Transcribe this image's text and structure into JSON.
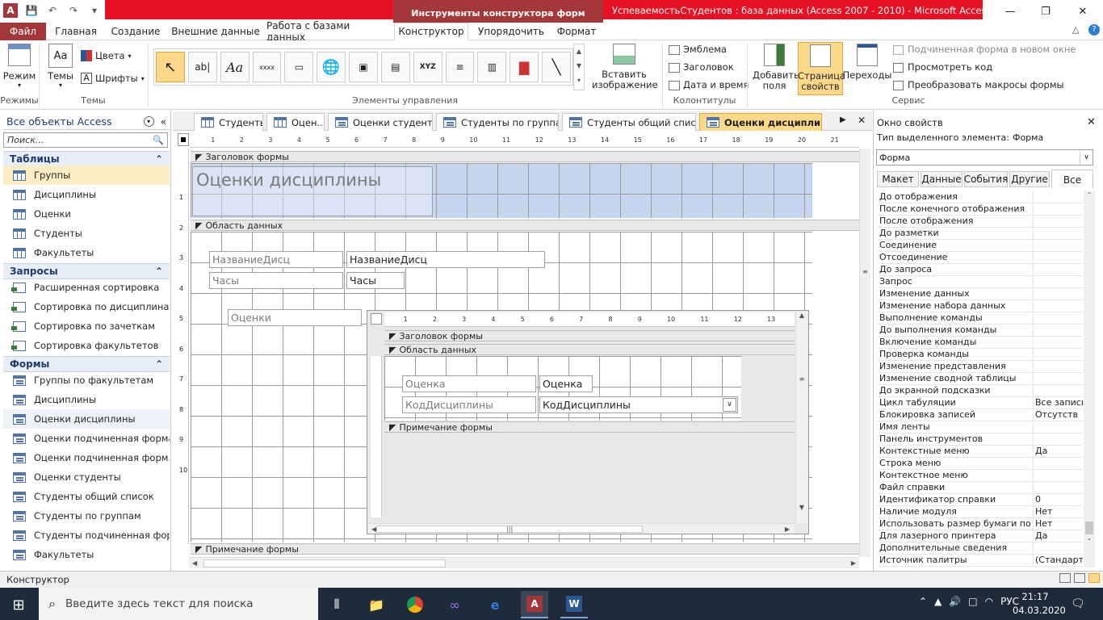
{
  "window": {
    "context_tools": "Инструменты конструктора форм",
    "title": "УспеваемостьСтудентов : база данных (Access 2007 - 2010) -  Microsoft Access (С...",
    "help": "?"
  },
  "ribbon_tabs": [
    "Файл",
    "Главная",
    "Создание",
    "Внешние данные",
    "Работа с базами данных",
    "Конструктор",
    "Упорядочить",
    "Формат"
  ],
  "ribbon": {
    "mode_label": "Режим",
    "themes_label": "Темы",
    "colors_label": "Цвета",
    "fonts_label": "Шрифты",
    "insert_image_label": "Вставить изображение",
    "emblem": "Эмблема",
    "header": "Заголовок",
    "datetime": "Дата и время",
    "add_fields": "Добавить поля",
    "property_sheet": "Страница свойств",
    "transitions": "Переходы",
    "subform_new_window": "Подчиненная форма в новом окне",
    "view_code": "Просмотреть код",
    "convert_macros": "Преобразовать макросы формы",
    "groups": {
      "modes": "Режимы",
      "themes": "Темы",
      "controls": "Элементы управления",
      "header_footer": "Колонтитулы",
      "service": "Сервис"
    },
    "controls_xyz": "XYZ",
    "controls_textbox": "ab|",
    "controls_label": "Aa",
    "controls_button": "xxxx"
  },
  "nav": {
    "title": "Все объекты Access",
    "search_placeholder": "Поиск...",
    "tables_header": "Таблицы",
    "tables": [
      "Группы",
      "Дисциплины",
      "Оценки",
      "Студенты",
      "Факультеты"
    ],
    "queries_header": "Запросы",
    "queries": [
      "Расширенная сортировка",
      "Сортировка по дисциплинам",
      "Сортировка по зачеткам",
      "Сортировка факультетов"
    ],
    "forms_header": "Формы",
    "forms": [
      "Группы по факультетам",
      "Дисциплины",
      "Оценки дисциплины",
      "Оценки подчиненная форма",
      "Оценки подчиненная форм...",
      "Оценки студенты",
      "Студенты общий список",
      "Студенты по группам",
      "Студенты подчиненная фор...",
      "Факультеты"
    ]
  },
  "doc_tabs": [
    "Студенты",
    "Оцен...",
    "Оценки студенты",
    "Студенты по группам",
    "Студенты общий список",
    "Оценки дисциплины"
  ],
  "design": {
    "ruler_marks": [
      "1",
      "2",
      "3",
      "4",
      "5",
      "6",
      "7",
      "8",
      "9",
      "10",
      "11",
      "12",
      "13",
      "14",
      "15",
      "16",
      "17",
      "18",
      "19",
      "20",
      "21"
    ],
    "vruler_marks": [
      "1",
      "2",
      "3",
      "4",
      "5",
      "6",
      "7",
      "8",
      "9",
      "10"
    ],
    "form_header": "Заголовок формы",
    "form_title": "Оценки дисциплины",
    "detail": "Область данных",
    "label_name": "НазваниеДисц",
    "field_name": "НазваниеДисц",
    "label_hours": "Часы",
    "field_hours": "Часы",
    "label_grades": "Оценки",
    "form_footer": "Примечание формы",
    "subform": {
      "ruler_marks": [
        "1",
        "2",
        "3",
        "4",
        "5",
        "6",
        "7",
        "8",
        "9",
        "10",
        "11",
        "12",
        "13"
      ],
      "header": "Заголовок формы",
      "detail": "Область данных",
      "label_grade": "Оценка",
      "field_grade": "Оценка",
      "label_code": "КодДисциплины",
      "field_code": "КодДисциплины",
      "footer": "Примечание формы"
    }
  },
  "props": {
    "title": "Окно свойств",
    "selection_type_label": "Тип выделенного элемента:",
    "selection_type": "Форма",
    "selected_object": "Форма",
    "tabs": [
      "Макет",
      "Данные",
      "События",
      "Другие",
      "Все"
    ],
    "rows": [
      [
        "До отображения",
        ""
      ],
      [
        "После конечного отображения",
        ""
      ],
      [
        "После отображения",
        ""
      ],
      [
        "До разметки",
        ""
      ],
      [
        "Соединение",
        ""
      ],
      [
        "Отсоединение",
        ""
      ],
      [
        "До запроса",
        ""
      ],
      [
        "Запрос",
        ""
      ],
      [
        "Изменение данных",
        ""
      ],
      [
        "Изменение набора данных",
        ""
      ],
      [
        "Выполнение команды",
        ""
      ],
      [
        "До выполнения команды",
        ""
      ],
      [
        "Включение команды",
        ""
      ],
      [
        "Проверка команды",
        ""
      ],
      [
        "Изменение представления",
        ""
      ],
      [
        "Изменение сводной таблицы",
        ""
      ],
      [
        "До экранной подсказки",
        ""
      ],
      [
        "Цикл табуляции",
        "Все записи"
      ],
      [
        "Блокировка записей",
        "Отсутств"
      ],
      [
        "Имя ленты",
        ""
      ],
      [
        "Панель инструментов",
        ""
      ],
      [
        "Контекстные меню",
        "Да"
      ],
      [
        "Строка меню",
        ""
      ],
      [
        "Контекстное меню",
        ""
      ],
      [
        "Файл справки",
        ""
      ],
      [
        "Идентификатор справки",
        "0"
      ],
      [
        "Наличие модуля",
        "Нет"
      ],
      [
        "Использовать размер бумаги по ум",
        "Нет"
      ],
      [
        "Для лазерного принтера",
        "Да"
      ],
      [
        "Дополнительные сведения",
        ""
      ],
      [
        "Источник палитры",
        "(Стандартн"
      ]
    ]
  },
  "status": "Конструктор",
  "taskbar": {
    "search_placeholder": "Введите здесь текст для поиска",
    "lang": "РУС",
    "time": "21:17",
    "date": "04.03.2020"
  }
}
